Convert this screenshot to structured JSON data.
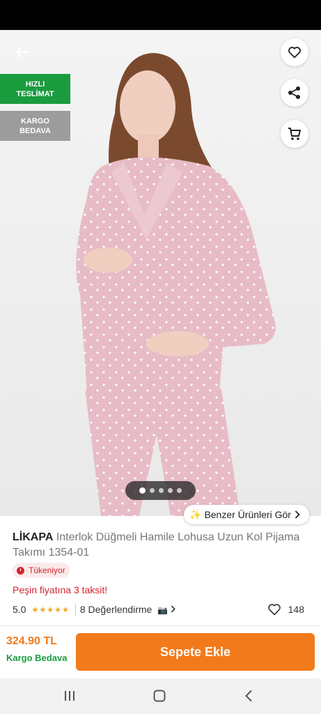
{
  "product": {
    "brand": "LİKAPA",
    "name": "Interlok Düğmeli Hamile Lohusa Uzun Kol Pijama Takımı 1354-01"
  },
  "badges": {
    "fast_delivery": [
      "HIZLI",
      "TESLİMAT"
    ],
    "free_cargo": [
      "KARGO",
      "BEDAVA"
    ]
  },
  "gallery": {
    "image_count": 5,
    "active_index": 0
  },
  "similar_button": {
    "label": "Benzer Ürünleri Gör"
  },
  "stock": {
    "label": "Tükeniyor"
  },
  "installment": {
    "text": "Peşin fiyatına 3 taksit!"
  },
  "rating": {
    "score": "5.0",
    "stars": 5,
    "reviews_label": "8 Değerlendirme",
    "favorites": "148"
  },
  "purchase": {
    "price": "324.90 TL",
    "cargo": "Kargo Bedava",
    "add_to_cart": "Sepete Ekle"
  },
  "icons": [
    "back-arrow-icon",
    "heart-icon",
    "share-icon",
    "cart-icon",
    "sparkle-icon",
    "chevron-right-icon",
    "clock-icon",
    "star-icon",
    "camera-icon",
    "recent-apps-icon",
    "home-icon",
    "nav-back-icon"
  ],
  "colors": {
    "accent": "#f27a1a",
    "green": "#1a9b3e",
    "red": "#d0252f",
    "badge_grey": "#9c9c9c",
    "star": "#f5a623"
  }
}
